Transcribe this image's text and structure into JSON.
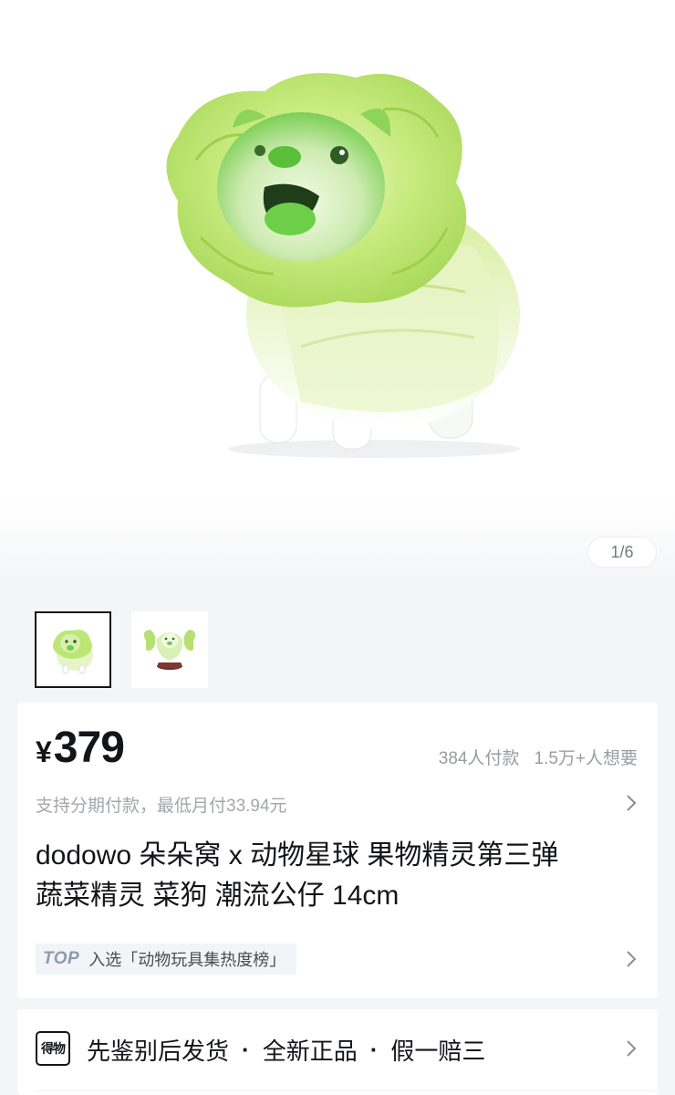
{
  "gallery": {
    "page_indicator": "1/6",
    "thumbnails": [
      {
        "name": "cabbage-dog-figure-front",
        "active": true
      },
      {
        "name": "cabbage-dog-figure-group",
        "active": false
      }
    ]
  },
  "product": {
    "currency": "¥",
    "price": "379",
    "paid_count": "384人付款",
    "want_count": "1.5万+人想要",
    "installment": "支持分期付款，最低月付33.94元",
    "title_line1": "dodowo 朵朵窝 x 动物星球 果物精灵第三弹",
    "title_line2": "蔬菜精灵 菜狗 潮流公仔 14cm",
    "rank_badge": "TOP",
    "rank_text": "入选「动物玩具集热度榜」"
  },
  "guarantee": {
    "logo": "得物",
    "items": [
      "先鉴别后发货",
      "全新正品",
      "假一赔三"
    ],
    "separator": "·"
  },
  "icons": {
    "chevron": "chevron-right-icon"
  },
  "colors": {
    "background": "#f4f5f7",
    "text_primary": "#14151a",
    "text_secondary": "#9a9ca3",
    "cabbage_green": "#b6e07a"
  }
}
